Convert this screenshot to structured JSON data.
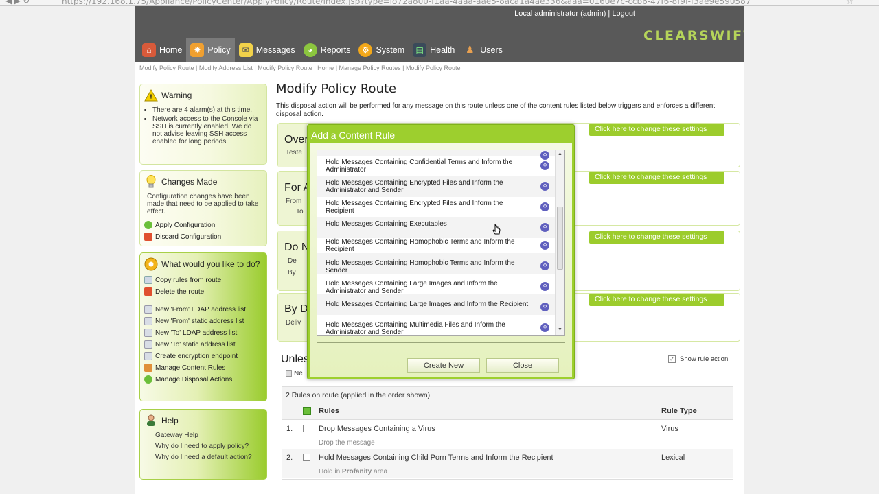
{
  "browser": {
    "url": "https://192.168.1.75/Appliance/PolicyCenter/ApplyPolicy/Route/index.jsp?type=lo72a800-f1aa-4aaa-aae5-8aca1a4ae336&aaa=0160e7c-ccb6-47f6-8f9f-f3ae9e590587"
  },
  "header": {
    "user": "Local administrator (admin)",
    "separator": "|",
    "logout": "Logout",
    "logo": "CLEARSWIFT"
  },
  "nav": [
    {
      "label": "Home",
      "icon": "home-icon",
      "color": "#c0392b"
    },
    {
      "label": "Policy",
      "icon": "policy-icon",
      "color": "#e67e22"
    },
    {
      "label": "Messages",
      "icon": "envelope-icon",
      "color": "#f1c40f"
    },
    {
      "label": "Reports",
      "icon": "pie-chart-icon",
      "color": "#7dbb2a"
    },
    {
      "label": "System",
      "icon": "gear-icon",
      "color": "#f39c12"
    },
    {
      "label": "Health",
      "icon": "monitor-icon",
      "color": "#2c3e50"
    },
    {
      "label": "Users",
      "icon": "users-icon",
      "color": "#8e44ad"
    }
  ],
  "breadcrumb": [
    "Modify Policy Route",
    "Modify Address List",
    "Modify Policy Route",
    "Home",
    "Manage Policy Routes",
    "Modify Policy Route"
  ],
  "breadcrumb_sep": " | ",
  "warning": {
    "title": "Warning",
    "items": [
      "There are 4 alarm(s) at this time.",
      "Network access to the Console via SSH is currently enabled. We do not advise leaving SSH access enabled for long periods."
    ]
  },
  "changes": {
    "title": "Changes Made",
    "text": "Configuration changes have been made that need to be applied to take effect.",
    "apply": "Apply Configuration",
    "discard": "Discard Configuration"
  },
  "actions": {
    "title": "What would you like to do?",
    "items": [
      "Copy rules from route",
      "Delete the route",
      "New 'From' LDAP address list",
      "New 'From' static address list",
      "New 'To' LDAP address list",
      "New 'To' static address list",
      "Create encryption endpoint",
      "Manage Content Rules",
      "Manage Disposal Actions"
    ]
  },
  "help": {
    "title": "Help",
    "items": [
      "Gateway Help",
      "Why do I need to apply policy?",
      "Why do I need a default action?"
    ]
  },
  "main": {
    "title": "Modify Policy Route",
    "desc": "This disposal action will be performed for any message on this route unless one of the content rules listed below triggers and enforces a different disposal action.",
    "sections": [
      {
        "title": "Over",
        "sub": "Teste"
      },
      {
        "title": "For A",
        "sub": "From",
        "sub2": "To"
      },
      {
        "title": "Do N",
        "sub": "De",
        "sub2": "By"
      },
      {
        "title": "By D",
        "sub": "Deliv"
      }
    ],
    "change_btn": "Click here to change these settings",
    "unless": "Unles",
    "new_label": "Ne",
    "show_rule": "Show rule action",
    "rules_count": "2 Rules on route (applied in the order shown)",
    "col_rules": "Rules",
    "col_type": "Rule Type",
    "rules": [
      {
        "num": "1.",
        "name": "Drop Messages Containing a Virus",
        "action": "Drop the message",
        "type": "Virus"
      },
      {
        "num": "2.",
        "name": "Hold Messages Containing Child Porn Terms and Inform the Recipient",
        "action_pre": "Hold in ",
        "action_bold": "Profanity",
        "action_post": " area",
        "type": "Lexical"
      }
    ]
  },
  "modal": {
    "title": "Add a Content Rule",
    "items": [
      "Hold Messages Containing Confidential Terms and Inform the Administrator",
      "Hold Messages Containing Encrypted Files and Inform the Administrator and Sender",
      "Hold Messages Containing Encrypted Files and Inform the Recipient",
      "Hold Messages Containing Executables",
      "Hold Messages Containing Homophobic Terms and Inform the Recipient",
      "Hold Messages Containing Homophobic Terms and Inform the Sender",
      "Hold Messages Containing Large Images and Inform the Administrator and Sender",
      "Hold Messages Containing Large Images and Inform the Recipient",
      "Hold Messages Containing Multimedia Files and Inform the Administrator and Sender"
    ],
    "create": "Create New",
    "close": "Close"
  }
}
